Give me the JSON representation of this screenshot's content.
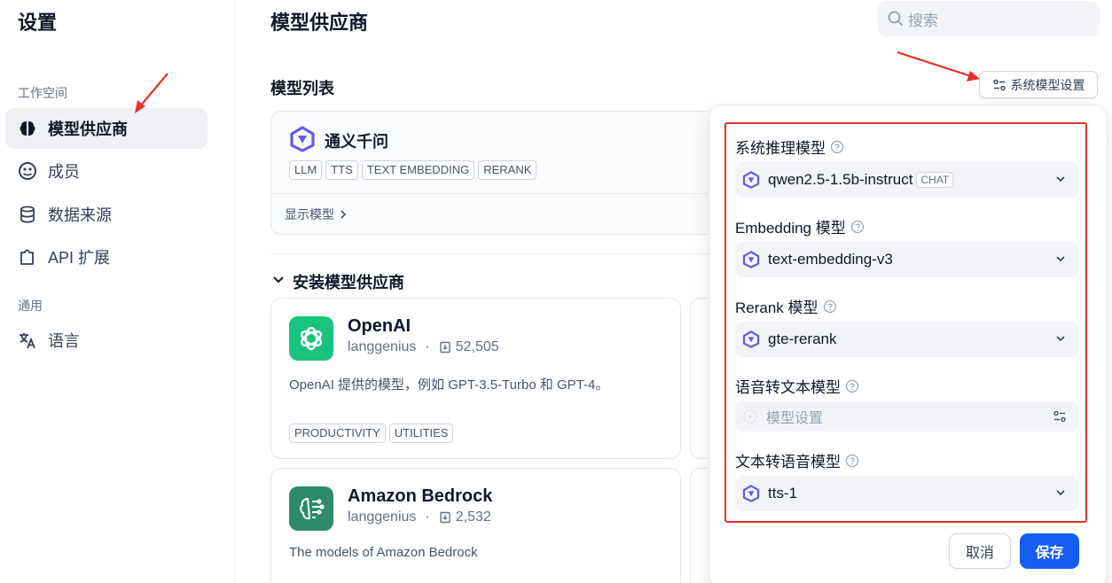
{
  "sidebar": {
    "title": "设置",
    "workspace_label": "工作空间",
    "items": [
      {
        "label": "模型供应商",
        "icon": "brain-icon"
      },
      {
        "label": "成员",
        "icon": "team-icon"
      },
      {
        "label": "数据来源",
        "icon": "database-icon"
      },
      {
        "label": "API 扩展",
        "icon": "puzzle-icon"
      }
    ],
    "general_label": "通用",
    "general_items": [
      {
        "label": "语言",
        "icon": "translate-icon"
      }
    ]
  },
  "header": {
    "title": "模型供应商",
    "search_placeholder": "搜索"
  },
  "model_list": {
    "title": "模型列表",
    "system_settings_button": "系统模型设置",
    "provider": {
      "name": "通义千问",
      "tags": [
        "LLM",
        "TTS",
        "TEXT EMBEDDING",
        "RERANK"
      ],
      "show_models": "显示模型"
    }
  },
  "install": {
    "title": "安装模型供应商",
    "cards": [
      {
        "name": "OpenAI",
        "author": "langgenius",
        "downloads": "52,505",
        "description": "OpenAI 提供的模型，例如 GPT-3.5-Turbo 和 GPT-4。",
        "tags": [
          "PRODUCTIVITY",
          "UTILITIES"
        ],
        "color": "#19c37d"
      },
      {
        "name": "Amazon Bedrock",
        "author": "langgenius",
        "downloads": "2,532",
        "description": "The models of Amazon Bedrock",
        "tags": [],
        "color": "#2e8b6a"
      }
    ]
  },
  "system_model_popover": {
    "fields": [
      {
        "label": "系统推理模型",
        "value": "qwen2.5-1.5b-instruct",
        "badge": "CHAT"
      },
      {
        "label": "Embedding 模型",
        "value": "text-embedding-v3"
      },
      {
        "label": "Rerank 模型",
        "value": "gte-rerank"
      },
      {
        "label": "语音转文本模型",
        "placeholder": "模型设置"
      },
      {
        "label": "文本转语音模型",
        "value": "tts-1"
      }
    ],
    "cancel": "取消",
    "save": "保存"
  },
  "colors": {
    "accent": "#155eef",
    "highlight_red": "#e5302e",
    "qwen_purple": "#615ced"
  }
}
